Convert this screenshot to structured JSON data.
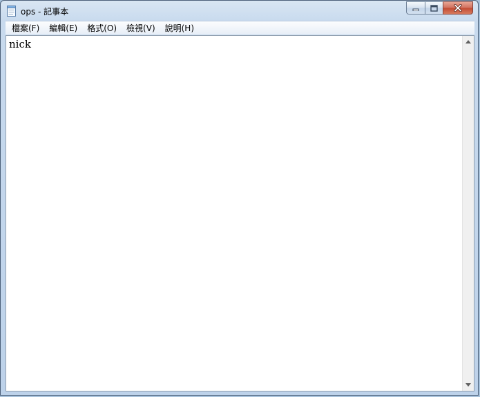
{
  "window": {
    "title": "ops - 記事本",
    "icon": "notepad-icon"
  },
  "controls": {
    "minimize_icon": "minimize-icon",
    "maximize_icon": "maximize-icon",
    "close_icon": "close-icon"
  },
  "menu": {
    "items": [
      {
        "label": "檔案(F)"
      },
      {
        "label": "編輯(E)"
      },
      {
        "label": "格式(O)"
      },
      {
        "label": "檢視(V)"
      },
      {
        "label": "說明(H)"
      }
    ]
  },
  "editor": {
    "content": "nick"
  },
  "colors": {
    "frame": "#bdd2ea",
    "close_button": "#c24a33",
    "editor_bg": "#ffffff"
  }
}
